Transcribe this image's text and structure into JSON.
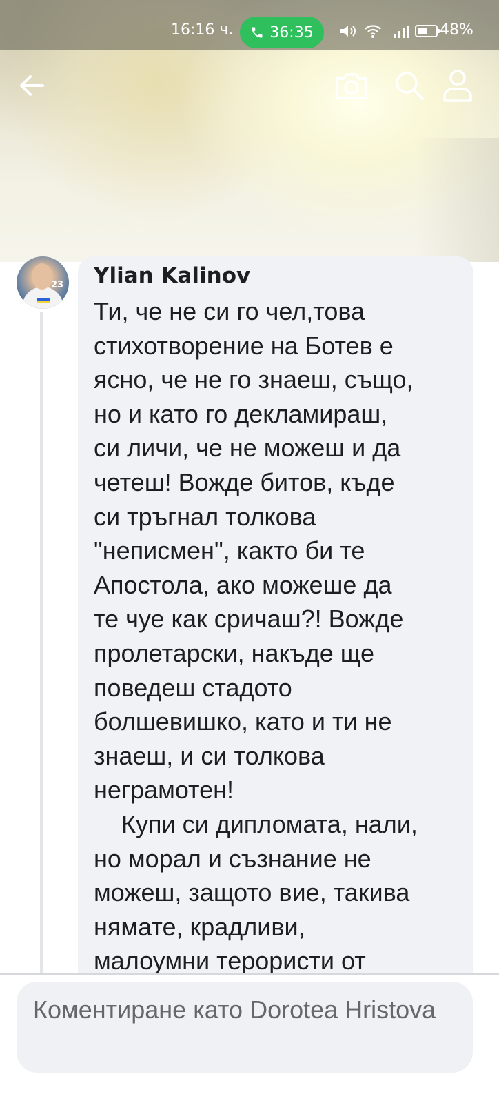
{
  "status_bar": {
    "time": "16:16 ч.",
    "call_timer": "36:35",
    "battery_percent": "48%"
  },
  "toolbar": {
    "icons": [
      "back-arrow-icon",
      "camera-icon",
      "search-icon",
      "profile-icon"
    ]
  },
  "comment": {
    "author": "Ylian Kalinov",
    "avatar_badge": "23",
    "text_lines": [
      "Ти, че не си го чел,това",
      "стихотворение на Ботев е",
      "ясно, че не го знаеш, също,",
      "но и като го декламираш,",
      "си личи, че не можеш и да",
      "четеш! Вожде битов, къде",
      "си тръгнал толкова",
      "\"неписмен\", както би те",
      "Апостола, ако можеше да",
      "те чуе как сричаш?! Вожде",
      "пролетарски, накъде ще",
      "поведеш стадото",
      "болшевишко, като и ти не",
      "знаеш, и си толкова",
      "неграмотен!",
      "    Купи си дипломата, нали,",
      "но морал и съзнание не",
      "можеш, защото вие, такива",
      "нямате, крадливи,",
      "малоумни терористи от"
    ]
  },
  "composer": {
    "placeholder": "Коментиране като Dorotea Hristova"
  }
}
